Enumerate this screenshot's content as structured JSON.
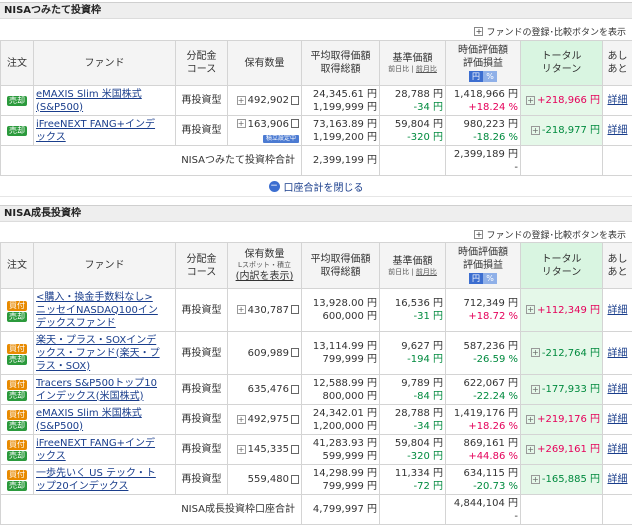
{
  "tsumitate": {
    "title": "NISAつみたて投資枠",
    "toolbar_link": "ファンドの登録･比較ボタンを表示",
    "headers": {
      "order": "注文",
      "fund": "ファンド",
      "dist_line1": "分配金",
      "dist_line2": "コース",
      "holdings": "保有数量",
      "avg_line1": "平均取得価額",
      "avg_line2": "取得総額",
      "base_line1": "基準価額",
      "base_sub1": "前日比",
      "base_sub2": "前月比",
      "eval_line1": "時価評価額",
      "eval_line2": "評価損益",
      "toggle_yen": "円",
      "toggle_pct": "%",
      "total_line1": "トータル",
      "total_line2": "リターン",
      "other_line1": "あし",
      "other_line2": "あと"
    },
    "rows": [
      {
        "badge": "売却",
        "fund_line1": "eMAXIS Slim 米国株式",
        "fund_line2": "(S&P500)",
        "course": "再投資型",
        "qty": "492,902",
        "qty_chip": "",
        "avg": "24,345.61 円",
        "acq": "1,199,999 円",
        "price": "28,788 円",
        "price_chg": "-34 円",
        "mv": "1,418,966 円",
        "pl_pct": "+18.24 %",
        "total": "+218,966 円",
        "detail": "詳細"
      },
      {
        "badge": "売却",
        "fund_line1": "iFreeNEXT FANG+インデ",
        "fund_line2": "ックス",
        "course": "再投資型",
        "qty": "163,906",
        "qty_chip": "積立設定中",
        "avg": "73,163.89 円",
        "acq": "1,199,200 円",
        "price": "59,804 円",
        "price_chg": "-320 円",
        "mv": "980,223 円",
        "pl_pct": "-18.26 %",
        "total": "-218,977 円",
        "detail": "詳細"
      }
    ],
    "summary": {
      "label": "NISAつみたて投資枠合計",
      "acq": "2,399,199 円",
      "mv": "2,399,189 円",
      "pl": "-"
    },
    "close_label": "口座合計を閉じる"
  },
  "growth": {
    "title": "NISA成長投資枠",
    "toolbar_link": "ファンドの登録･比較ボタンを表示",
    "headers": {
      "order": "注文",
      "fund": "ファンド",
      "dist_line1": "分配金",
      "dist_line2": "コース",
      "holdings": "保有数量",
      "holdings_sub": "Lスポット・積立",
      "holdings_line3": "(内訳を表示)",
      "avg_line1": "平均取得価額",
      "avg_line2": "取得総額",
      "base_line1": "基準価額",
      "base_sub1": "前日比",
      "base_sub2": "前月比",
      "eval_line1": "時価評価額",
      "eval_line2": "評価損益",
      "toggle_yen": "円",
      "toggle_pct": "%",
      "total_line1": "トータル",
      "total_line2": "リターン",
      "other_line1": "あし",
      "other_line2": "あと"
    },
    "buy_label": "買付",
    "sell_label": "売却",
    "rows": [
      {
        "fund_line1": "<購入・換金手数料なし>",
        "fund_line2": "ニッセイNASDAQ100イン",
        "fund_line3": "デックスファンド",
        "course": "再投資型",
        "qty": "430,787",
        "avg": "13,928.00 円",
        "acq": "600,000 円",
        "price": "16,536 円",
        "price_chg": "-31 円",
        "mv": "712,349 円",
        "pl_pct": "+18.72 %",
        "total": "+112,349 円",
        "detail": "詳細"
      },
      {
        "fund_line1": "楽天・プラス・SOXインデ",
        "fund_line2": "ックス・ファンド(楽天・プ",
        "fund_line3": "ラス・SOX)",
        "course": "再投資型",
        "qty": "609,989",
        "avg": "13,114.99 円",
        "acq": "799,999 円",
        "price": "9,627 円",
        "price_chg": "-194 円",
        "mv": "587,236 円",
        "pl_pct": "-26.59 %",
        "total": "-212,764 円",
        "detail": "詳細"
      },
      {
        "fund_line1": "Tracers S&P500トップ10",
        "fund_line2": "インデックス(米国株式)",
        "fund_line3": "",
        "course": "再投資型",
        "qty": "635,476",
        "avg": "12,588.99 円",
        "acq": "800,000 円",
        "price": "9,789 円",
        "price_chg": "-84 円",
        "mv": "622,067 円",
        "pl_pct": "-22.24 %",
        "total": "-177,933 円",
        "detail": "詳細"
      },
      {
        "fund_line1": "eMAXIS Slim 米国株式",
        "fund_line2": "(S&P500)",
        "fund_line3": "",
        "course": "再投資型",
        "qty": "492,975",
        "avg": "24,342.01 円",
        "acq": "1,200,000 円",
        "price": "28,788 円",
        "price_chg": "-34 円",
        "mv": "1,419,176 円",
        "pl_pct": "+18.26 %",
        "total": "+219,176 円",
        "detail": "詳細"
      },
      {
        "fund_line1": "iFreeNEXT FANG+インデ",
        "fund_line2": "ックス",
        "fund_line3": "",
        "course": "再投資型",
        "qty": "145,335",
        "avg": "41,283.93 円",
        "acq": "599,999 円",
        "price": "59,804 円",
        "price_chg": "-320 円",
        "mv": "869,161 円",
        "pl_pct": "+44.86 %",
        "total": "+269,161 円",
        "detail": "詳細"
      },
      {
        "fund_line1": "一歩先いく US テック・ト",
        "fund_line2": "ップ20インデックス",
        "fund_line3": "",
        "course": "再投資型",
        "qty": "559,480",
        "avg": "14,298.99 円",
        "acq": "799,999 円",
        "price": "11,334 円",
        "price_chg": "-72 円",
        "mv": "634,115 円",
        "pl_pct": "-20.73 %",
        "total": "-165,885 円",
        "detail": "詳細"
      }
    ],
    "summary": {
      "label": "NISA成長投資枠口座合計",
      "acq": "4,799,997 円",
      "mv": "4,844,104 円",
      "pl": "-"
    }
  },
  "colors": {
    "gain": "#e5005a",
    "loss": "#008a3e",
    "total_bg": "#e5f8e9",
    "link": "#1a3e8c"
  }
}
